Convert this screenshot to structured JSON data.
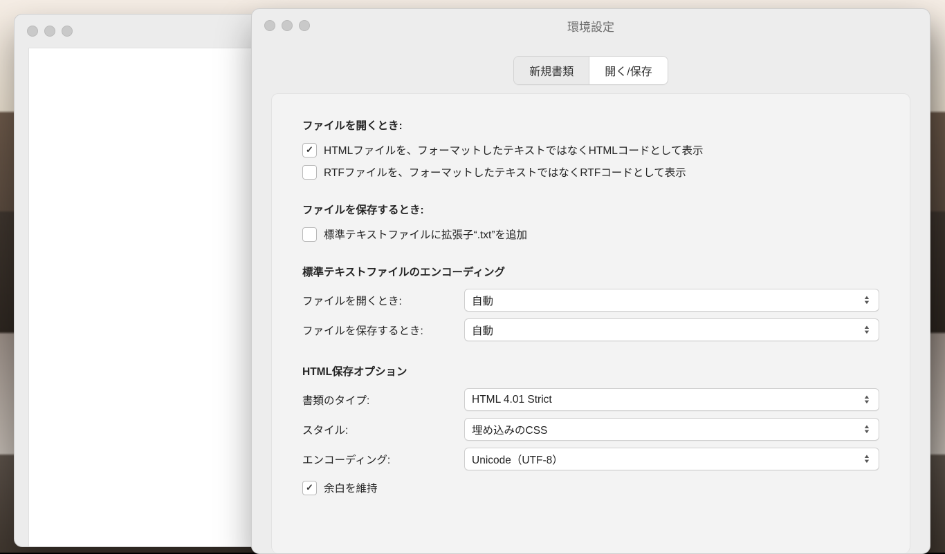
{
  "background_window": {
    "title": ""
  },
  "preferences": {
    "title": "環境設定",
    "tabs": {
      "new_document": "新規書類",
      "open_save": "開く/保存",
      "active": "open_save"
    },
    "open_section": {
      "heading": "ファイルを開くとき:",
      "html_checkbox": {
        "checked": true,
        "label": "HTMLファイルを、フォーマットしたテキストではなくHTMLコードとして表示"
      },
      "rtf_checkbox": {
        "checked": false,
        "label": "RTFファイルを、フォーマットしたテキストではなくRTFコードとして表示"
      }
    },
    "save_section": {
      "heading": "ファイルを保存するとき:",
      "txt_checkbox": {
        "checked": false,
        "label": "標準テキストファイルに拡張子“.txt”を追加"
      }
    },
    "encoding_section": {
      "heading": "標準テキストファイルのエンコーディング",
      "open": {
        "label": "ファイルを開くとき:",
        "value": "自動"
      },
      "save": {
        "label": "ファイルを保存するとき:",
        "value": "自動"
      }
    },
    "html_section": {
      "heading": "HTML保存オプション",
      "doc_type": {
        "label": "書類のタイプ:",
        "value": "HTML 4.01 Strict"
      },
      "style": {
        "label": "スタイル:",
        "value": "埋め込みのCSS"
      },
      "encoding": {
        "label": "エンコーディング:",
        "value": "Unicode（UTF-8）"
      },
      "preserve_whitespace": {
        "checked": true,
        "label": "余白を維持"
      }
    }
  }
}
